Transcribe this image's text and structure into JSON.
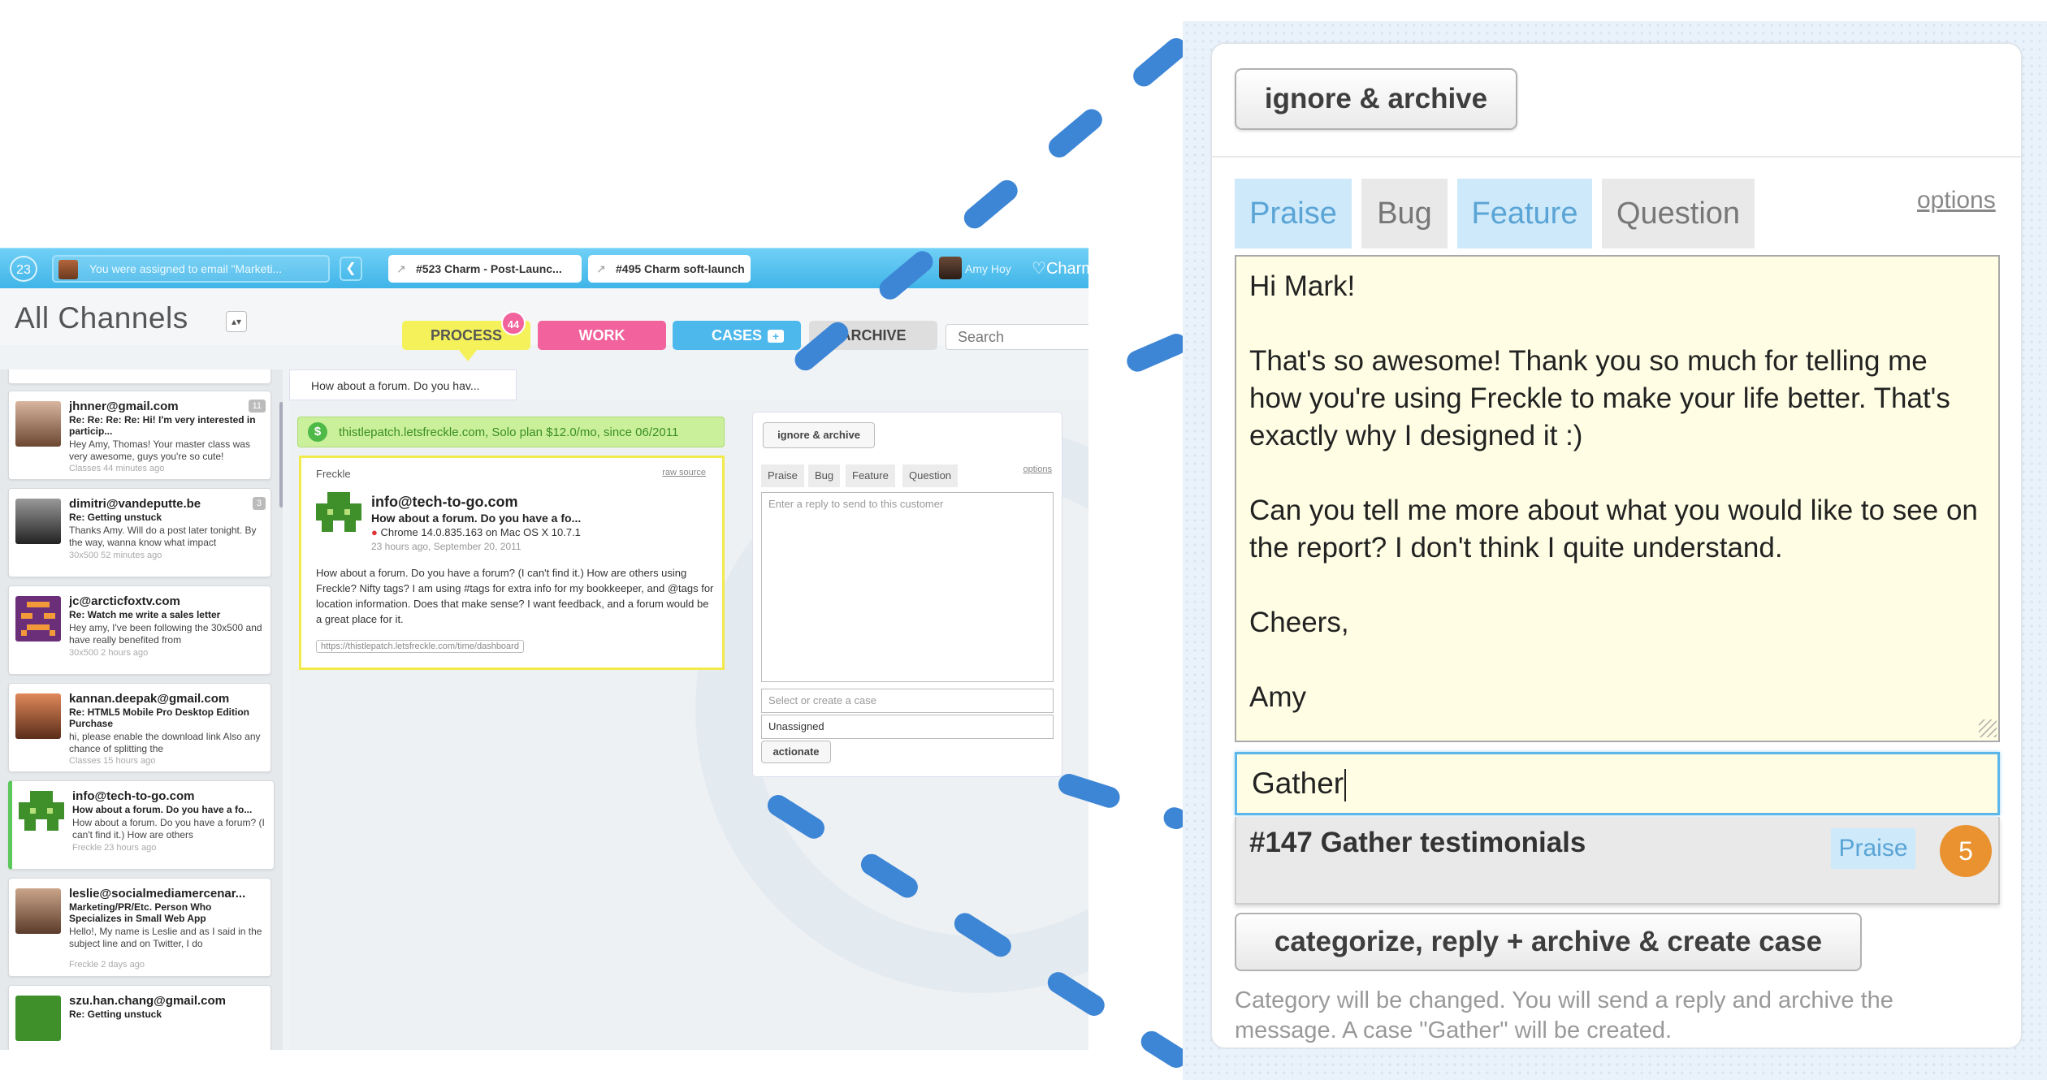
{
  "app": {
    "notification_count": "23",
    "notification_text": "You were assigned to email \"Marketi...",
    "tabs": [
      "#523 Charm - Post-Launc...",
      "#495 Charm soft-launch"
    ],
    "user_name": "Amy Hoy",
    "app_name": "Charm",
    "channel_title": "All Channels",
    "stage_buttons": {
      "process": "PROCESS",
      "work": "WORK",
      "cases": "CASES",
      "archive": "ARCHIVE"
    },
    "process_count": "44",
    "search_placeholder": "Search",
    "breadcrumb": "How about a forum. Do you hav...",
    "messages": [
      {
        "from": "jhnner@gmail.com",
        "subject": "Re: Re: Re: Re: Hi! I'm very interested in particip...",
        "preview": "Hey Amy, Thomas! Your master class was very awesome, guys you're so cute!",
        "meta": "Classes  44 minutes ago",
        "count": "11"
      },
      {
        "from": "dimitri@vandeputte.be",
        "subject": "Re: Getting unstuck",
        "preview": "Thanks Amy. Will do a post later tonight. By the way, wanna know what impact",
        "meta": "30x500  52 minutes ago",
        "count": "3"
      },
      {
        "from": "jc@arcticfoxtv.com",
        "subject": "Re: Watch me write a sales letter",
        "preview": "Hey amy, I've been following the 30x500 and have really benefited from",
        "meta": "30x500  2 hours ago",
        "count": ""
      },
      {
        "from": "kannan.deepak@gmail.com",
        "subject": "Re: HTML5 Mobile Pro Desktop Edition Purchase",
        "preview": "hi, please enable the download link Also any chance of splitting the",
        "meta": "Classes  15 hours ago",
        "count": ""
      },
      {
        "from": "info@tech-to-go.com",
        "subject": "How about a forum. Do you have a fo...",
        "preview": "How about a forum. Do you have a forum? (I can't find it.) How are others",
        "meta": "Freckle  23 hours ago",
        "count": ""
      },
      {
        "from": "leslie@socialmediamercenar...",
        "subject": "Marketing/PR/Etc. Person Who Specializes in Small Web App",
        "preview": "Hello!, My name is Leslie and as I said in the subject line and on Twitter, I do",
        "meta": "Freckle  2 days ago",
        "count": ""
      },
      {
        "from": "szu.han.chang@gmail.com",
        "subject": "Re: Getting unstuck",
        "preview": "",
        "meta": "",
        "count": ""
      }
    ],
    "account_line": "thistlepatch.letsfreckle.com, Solo plan $12.0/mo, since 06/2011",
    "message": {
      "source": "Freckle",
      "raw_link": "raw source",
      "from": "info@tech-to-go.com",
      "subject": "How about a forum. Do you have a fo...",
      "user_agent": "Chrome 14.0.835.163 on  Mac OS X 10.7.1",
      "when": "23 hours ago, September 20, 2011",
      "body": "How about a forum. Do you have a forum? (I can't find it.) How are others using Freckle? Nifty tags? I am using #tags for extra info for my bookkeeper, and @tags for location information. Does that make sense? I want feedback, and a forum would be a great place for it.",
      "url": "https://thistlepatch.letsfreckle.com/time/dashboard"
    },
    "reply": {
      "ignore_archive": "ignore & archive",
      "categories": [
        "Praise",
        "Bug",
        "Feature",
        "Question"
      ],
      "options": "options",
      "placeholder": "Enter a reply to send to this customer",
      "case_placeholder": "Select or create a case",
      "assignee": "Unassigned",
      "action": "actionate"
    }
  },
  "zoom": {
    "ignore_archive": "ignore & archive",
    "categories": [
      "Praise",
      "Bug",
      "Feature",
      "Question"
    ],
    "options": "options",
    "reply_text": "Hi Mark!\n\nThat's so awesome! Thank you so much for telling me how you're using Freckle to make your life better. That's exactly why I designed it :)\n\nCan you tell me more about what you would like to see on the report? I don't think I quite understand.\n\nCheers,\n\nAmy",
    "case_input": "Gather",
    "suggestion": {
      "name": "#147 Gather testimonials",
      "tag": "Praise",
      "count": "5"
    },
    "action_button": "categorize, reply + archive & create case",
    "note": "Category will be changed. You will send a reply and archive the message. A case \"Gather\" will be created."
  },
  "colors": {
    "process": "#f5f15a",
    "work": "#f2629c",
    "cases": "#4db8ec",
    "archive": "#dedede",
    "topbar": "#4fbef0",
    "callout": "#3d86d6",
    "selected_category": "#cde9fa",
    "case_count": "#e9922f"
  }
}
